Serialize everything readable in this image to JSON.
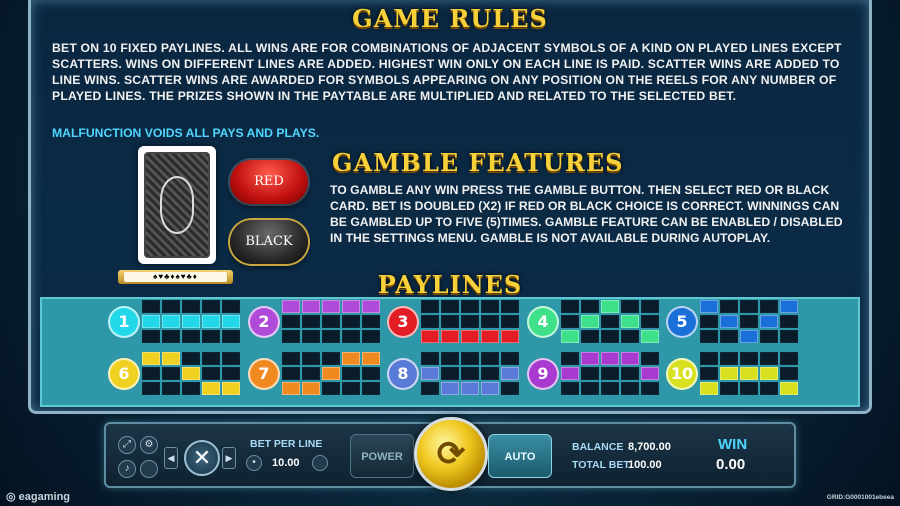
{
  "rules": {
    "title": "GAME RULES",
    "text": "BET ON 10 FIXED PAYLINES. ALL WINS ARE FOR COMBINATIONS OF ADJACENT SYMBOLS OF A KIND ON PLAYED LINES EXCEPT SCATTERS. WINS ON DIFFERENT LINES ARE ADDED. HIGHEST WIN ONLY ON EACH LINE IS PAID. SCATTER WINS ARE ADDED TO LINE WINS. SCATTER WINS ARE AWARDED FOR SYMBOLS APPEARING ON ANY POSITION ON THE REELS FOR ANY NUMBER OF PLAYED LINES. THE PRIZES SHOWN IN THE PAYTABLE ARE MULTIPLIED AND RELATED TO THE SELECTED BET.",
    "malfunction": "MALFUNCTION VOIDS ALL PAYS AND PLAYS."
  },
  "gamble": {
    "title": "GAMBLE FEATURES",
    "red_label": "RED",
    "black_label": "BLACK",
    "history": "♠♥♣♦♠♥♣♦",
    "text": "TO GAMBLE ANY WIN PRESS THE GAMBLE BUTTON. THEN SELECT RED OR BLACK CARD. BET IS DOUBLED (X2) IF RED OR BLACK CHOICE IS CORRECT. WINNINGS CAN BE GAMBLED UP TO FIVE (5)TIMES. GAMBLE FEATURE CAN BE ENABLED / DISABLED IN THE SETTINGS MENU. GAMBLE IS NOT AVAILABLE DURING AUTOPLAY."
  },
  "paylines": {
    "title": "PAYLINES",
    "lines": [
      {
        "n": "1",
        "color": "#22d8e8",
        "rows": [
          1,
          1,
          1,
          1,
          1
        ]
      },
      {
        "n": "2",
        "color": "#b04ad8",
        "rows": [
          0,
          0,
          0,
          0,
          0
        ]
      },
      {
        "n": "3",
        "color": "#e21e24",
        "rows": [
          2,
          2,
          2,
          2,
          2
        ]
      },
      {
        "n": "4",
        "color": "#3ee08a",
        "rows": [
          2,
          1,
          0,
          1,
          2
        ]
      },
      {
        "n": "5",
        "color": "#1a6fd8",
        "rows": [
          0,
          1,
          2,
          1,
          0
        ]
      },
      {
        "n": "6",
        "color": "#f0d020",
        "rows": [
          0,
          0,
          1,
          2,
          2
        ]
      },
      {
        "n": "7",
        "color": "#f08a20",
        "rows": [
          2,
          2,
          1,
          0,
          0
        ]
      },
      {
        "n": "8",
        "color": "#5a7ad8",
        "rows": [
          1,
          2,
          2,
          2,
          1
        ]
      },
      {
        "n": "9",
        "color": "#a83ad0",
        "rows": [
          1,
          0,
          0,
          0,
          1
        ]
      },
      {
        "n": "10",
        "color": "#d8e020",
        "rows": [
          2,
          1,
          1,
          1,
          2
        ]
      }
    ]
  },
  "controls": {
    "bet_per_line_label": "BET PER LINE",
    "bet_per_line": "10.00",
    "power_label": "POWER",
    "auto_label": "AUTO",
    "balance_label": "BALANCE",
    "balance": "8,700.00",
    "total_bet_label": "TOTAL BET",
    "total_bet": "100.00",
    "win_label": "WIN",
    "win": "0.00"
  },
  "footer": {
    "logo": "eagaming",
    "grid_id": "GRID:G0001001ebeea"
  },
  "colors": {
    "title_gold": "#f6d13a",
    "accent_cyan": "#4fd6ff",
    "panel_teal": "#2e98a8"
  }
}
